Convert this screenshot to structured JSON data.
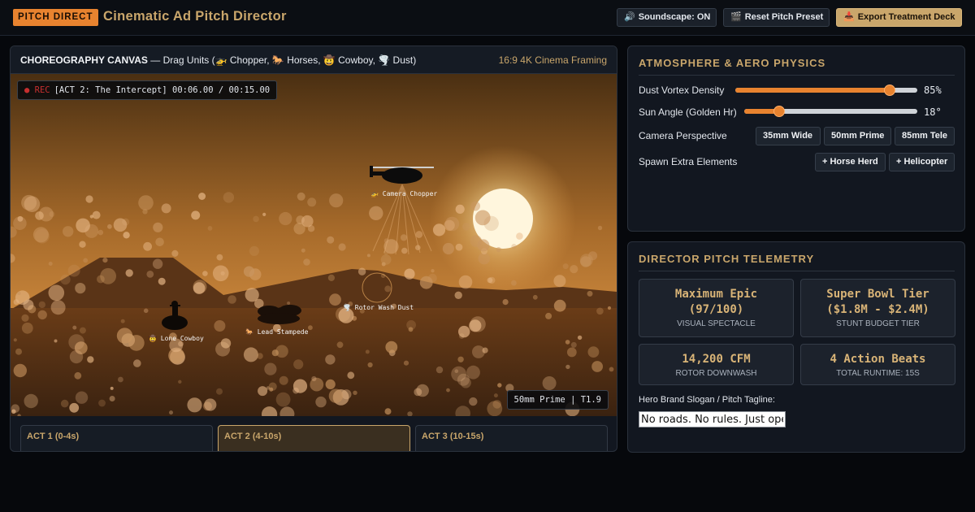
{
  "header": {
    "brand": "PITCH DIRECT",
    "title": "Cinematic Ad Pitch Director",
    "buttons": {
      "soundscape": {
        "icon": "speaker-icon",
        "glyph": "🔊",
        "label": "Soundscape: ON"
      },
      "reset": {
        "icon": "clapper-icon",
        "glyph": "🎬",
        "label": "Reset Pitch Preset"
      },
      "export": {
        "icon": "inbox-icon",
        "glyph": "📥",
        "label": "Export Treatment Deck"
      }
    }
  },
  "canvas": {
    "title": "CHOREOGRAPHY CANVAS",
    "subtitle": " — Drag Units (🚁 Chopper, 🐎 Horses, 🤠 Cowboy, 🌪️ Dust)",
    "framing": "16:9 4K Cinema Framing",
    "rec_label": "● REC",
    "timecode": "[ACT 2: The Intercept] 00:06.00 / 00:15.00",
    "lens_readout": "50mm Prime | T1.9",
    "units": {
      "chopper": "🚁 Camera Chopper",
      "dust": "🌪️ Rotor Wash Dust",
      "horses": "🐎 Lead Stampede",
      "cowboy": "🤠 Lone Cowboy"
    }
  },
  "acts": [
    {
      "label": "ACT 1 (0-4s)",
      "active": false
    },
    {
      "label": "ACT 2 (4-10s)",
      "active": true
    },
    {
      "label": "ACT 3 (10-15s)",
      "active": false
    }
  ],
  "atmosphere": {
    "title": "ATMOSPHERE & AERO PHYSICS",
    "dust_label": "Dust Vortex Density",
    "dust_value": 85,
    "dust_display": "85%",
    "sun_label": "Sun Angle (Golden Hr)",
    "sun_value": 18,
    "sun_max": 90,
    "sun_display": "18°",
    "camera_label": "Camera Perspective",
    "lenses": [
      "35mm Wide",
      "50mm Prime",
      "85mm Tele"
    ],
    "spawn_label": "Spawn Extra Elements",
    "spawn": [
      "+ Horse Herd",
      "+ Helicopter"
    ]
  },
  "telemetry": {
    "title": "DIRECTOR PITCH TELEMETRY",
    "epic": {
      "value": "Maximum Epic",
      "value2": "(97/100)",
      "label": "VISUAL SPECTACLE"
    },
    "budget": {
      "value": "Super Bowl Tier",
      "value2": "($1.8M - $2.4M)",
      "label": "STUNT BUDGET TIER"
    },
    "cfm": {
      "value": "14,200 CFM",
      "label": "ROTOR DOWNWASH"
    },
    "beats": {
      "value": "4 Action Beats",
      "label": "TOTAL RUNTIME: 15S"
    },
    "slogan_label": "Hero Brand Slogan / Pitch Tagline:",
    "slogan_value": "No roads. No rules. Just open"
  },
  "colors": {
    "accent": "#e8832f",
    "gold": "#c9a66b",
    "bg": "#06080c"
  }
}
